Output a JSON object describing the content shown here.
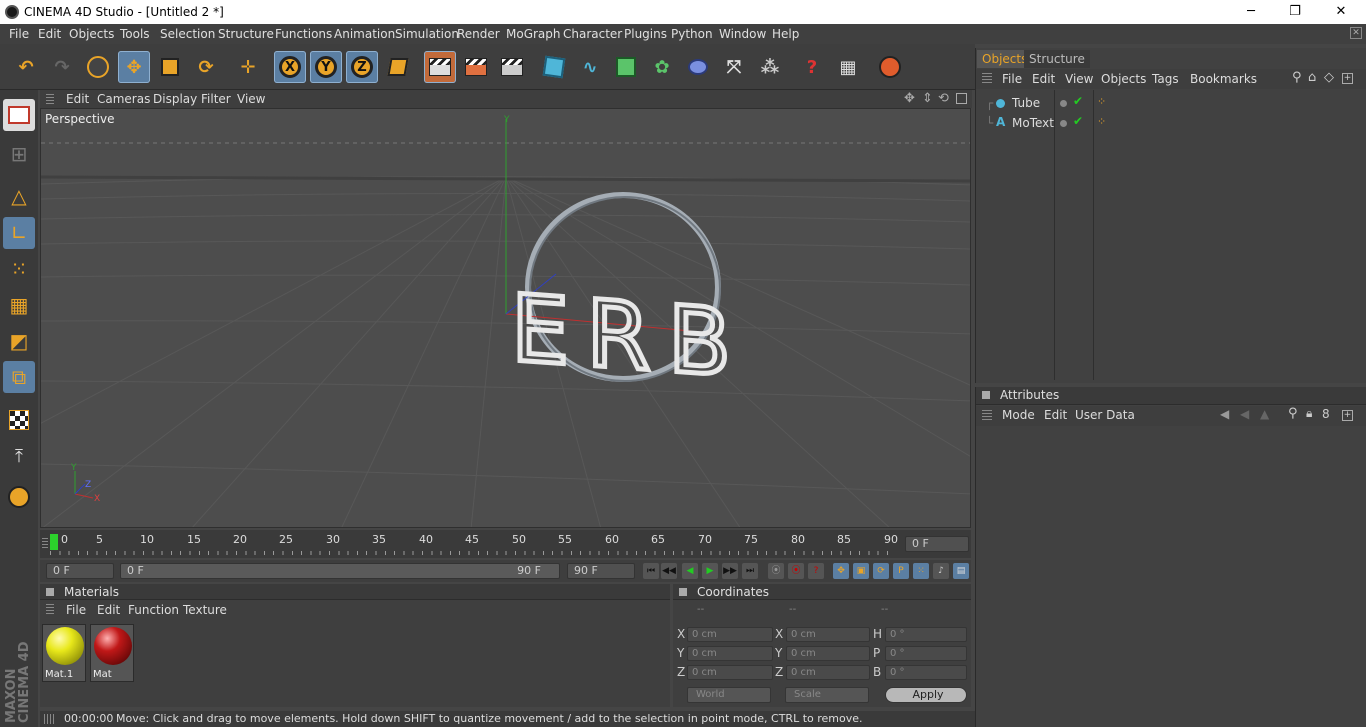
{
  "window": {
    "title": "CINEMA 4D Studio - [Untitled 2 *]",
    "min": "─",
    "max": "❐",
    "close": "✕"
  },
  "menu": [
    "File",
    "Edit",
    "Objects",
    "Tools",
    "Selection",
    "Structure",
    "Functions",
    "Animation",
    "Simulation",
    "Render",
    "MoGraph",
    "Character",
    "Plugins",
    "Python",
    "Window",
    "Help"
  ],
  "toolbar": {
    "axes": [
      "X",
      "Y",
      "Z"
    ]
  },
  "viewport": {
    "menu": [
      "Edit",
      "Cameras",
      "Display",
      "Filter",
      "View"
    ],
    "label": "Perspective",
    "axis_labels": {
      "y": "Y",
      "z": "Z",
      "x": "X"
    },
    "text3d": "ERB"
  },
  "timeline": {
    "ticks": [
      "0",
      "5",
      "10",
      "15",
      "20",
      "25",
      "30",
      "35",
      "40",
      "45",
      "50",
      "55",
      "60",
      "65",
      "70",
      "75",
      "80",
      "85",
      "90"
    ],
    "current_frame": "0 F"
  },
  "playbar": {
    "start": "0 F",
    "range_start": "0 F",
    "range_end": "90 F",
    "end": "90 F"
  },
  "materials": {
    "title": "Materials",
    "menu": [
      "File",
      "Edit",
      "Function",
      "Texture"
    ],
    "items": [
      {
        "name": "Mat.1",
        "color": "#e8e81a"
      },
      {
        "name": "Mat",
        "color": "#c01818"
      }
    ]
  },
  "coords": {
    "title": "Coordinates",
    "rows": [
      {
        "a": "X",
        "av": "0 cm",
        "b": "X",
        "bv": "0 cm",
        "c": "H",
        "cv": "0 °"
      },
      {
        "a": "Y",
        "av": "0 cm",
        "b": "Y",
        "bv": "0 cm",
        "c": "P",
        "cv": "0 °"
      },
      {
        "a": "Z",
        "av": "0 cm",
        "b": "Z",
        "bv": "0 cm",
        "c": "B",
        "cv": "0 °"
      }
    ],
    "headers": [
      "--",
      "--",
      "--"
    ],
    "world": "World",
    "scale": "Scale",
    "apply": "Apply"
  },
  "objects": {
    "tabs": [
      "Objects",
      "Structure"
    ],
    "menu": [
      "File",
      "Edit",
      "View",
      "Objects",
      "Tags",
      "Bookmarks"
    ],
    "items": [
      {
        "name": "Tube"
      },
      {
        "name": "MoText"
      }
    ]
  },
  "attributes": {
    "title": "Attributes",
    "menu": [
      "Mode",
      "Edit",
      "User Data"
    ]
  },
  "status": {
    "time": "00:00:00",
    "message": "Move: Click and drag to move elements. Hold down SHIFT to quantize movement / add to the selection in point mode, CTRL to remove."
  },
  "brand": {
    "line1": "MAXON",
    "line2": "CINEMA 4D"
  },
  "colors": {
    "accent": "#5b7fa3",
    "orange": "#e9a428",
    "tab_active": "#e9a428"
  }
}
